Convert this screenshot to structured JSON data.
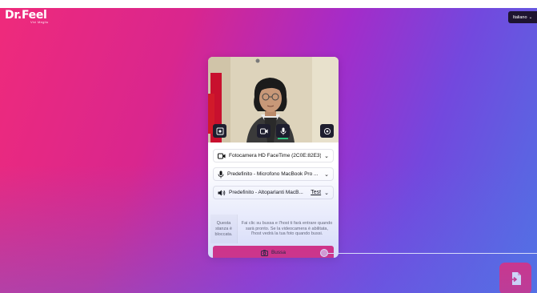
{
  "header": {
    "logo_text": "Dr.Feel",
    "logo_tagline": "Vivi Meglio",
    "language_label": "Italiano",
    "language_chevron": "⌄"
  },
  "video": {
    "controls": [
      "background-blur-icon",
      "camera-icon",
      "microphone-icon",
      "settings-icon"
    ]
  },
  "devices": {
    "camera_label": "Fotocamera HD FaceTime (2C0E:82E3)",
    "microphone_label": "Predefinito - Microfono MacBook Pro ...",
    "speaker_label": "Predefinito - Altoparlanti MacB...",
    "speaker_test_label": "Test"
  },
  "notice": {
    "locked_label": "Questa stanza è bloccata.",
    "message": "Fai clic su bussa e l'host ti farà entrare quando sarà pronto. Se la videocamera è abilitata, l'host vedrà la tua foto quando bussi."
  },
  "knock_button": {
    "label": "Bussa"
  },
  "colors": {
    "accent": "#f0236f",
    "background_gradient": [
      "#ef2a7b",
      "#a42cc9",
      "#4f72e4"
    ],
    "language_bg": "#1e1430"
  }
}
